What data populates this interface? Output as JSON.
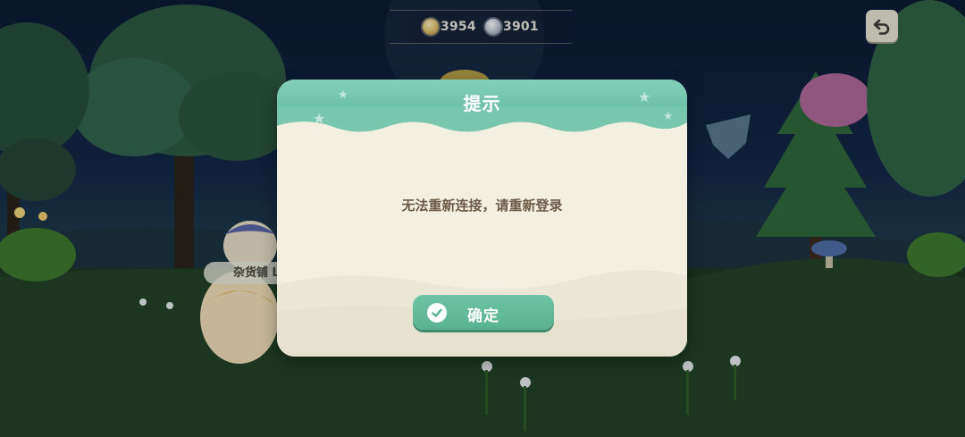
{
  "hud": {
    "gold_icon": "gold-coin-icon",
    "gold_value": "3954",
    "silver_icon": "silver-coin-icon",
    "silver_value": "3901"
  },
  "top_right": {
    "back_icon": "return-arrow-icon"
  },
  "world": {
    "shop_label": "杂货铺 L"
  },
  "dialog": {
    "title": "提示",
    "message": "无法重新连接，请重新登录",
    "confirm_label": "确定",
    "confirm_icon": "checkmark-icon"
  },
  "colors": {
    "dialog_header": "#6cc1a8",
    "dialog_body": "#f3efe1",
    "confirm_button": "#5fb896",
    "message_text": "#6b5a46"
  }
}
